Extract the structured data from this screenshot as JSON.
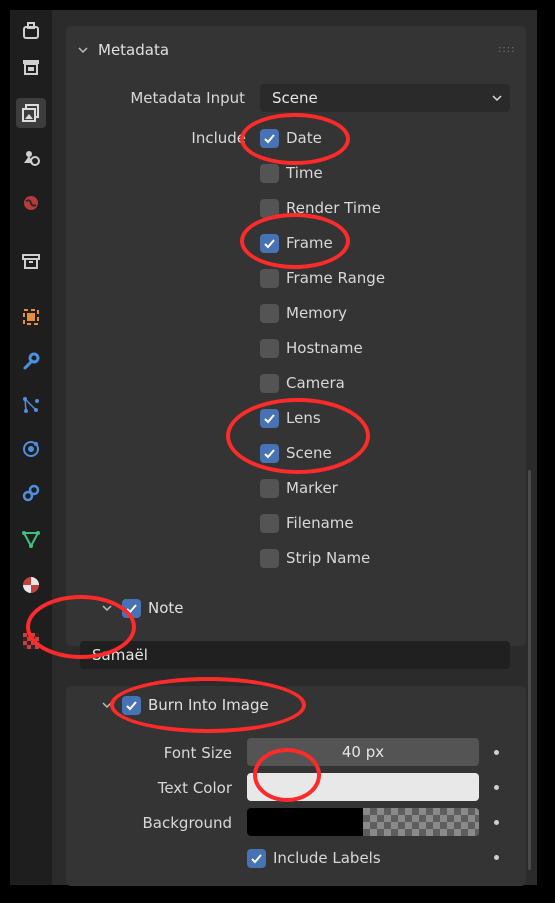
{
  "sidebar_tabs": [
    {
      "name": "tool-tab",
      "icon": "tool-icon"
    },
    {
      "name": "render-tab",
      "icon": "render-icon"
    },
    {
      "name": "output-tab",
      "icon": "output-icon",
      "active": true
    },
    {
      "name": "view-layer-tab",
      "icon": "view-layer-icon"
    },
    {
      "name": "scene-tab",
      "icon": "scene-icon"
    },
    {
      "name": "world-tab",
      "icon": "world-icon"
    },
    {
      "name": "collection-tab",
      "icon": "collection-icon"
    },
    {
      "name": "object-tab",
      "icon": "object-icon"
    },
    {
      "name": "modifier-tab",
      "icon": "wrench-icon"
    },
    {
      "name": "particles-tab",
      "icon": "particles-icon"
    },
    {
      "name": "physics-tab",
      "icon": "physics-icon"
    },
    {
      "name": "constraints-tab",
      "icon": "constraints-icon"
    },
    {
      "name": "data-tab",
      "icon": "mesh-data-icon"
    },
    {
      "name": "material-tab",
      "icon": "material-icon"
    },
    {
      "name": "texture-tab",
      "icon": "texture-icon"
    }
  ],
  "metadata": {
    "title": "Metadata",
    "input_label": "Metadata Input",
    "input_value": "Scene",
    "include_label": "Include",
    "items": [
      {
        "label": "Date",
        "checked": true
      },
      {
        "label": "Time",
        "checked": false
      },
      {
        "label": "Render Time",
        "checked": false
      },
      {
        "label": "Frame",
        "checked": true
      },
      {
        "label": "Frame Range",
        "checked": false
      },
      {
        "label": "Memory",
        "checked": false
      },
      {
        "label": "Hostname",
        "checked": false
      },
      {
        "label": "Camera",
        "checked": false
      },
      {
        "label": "Lens",
        "checked": true
      },
      {
        "label": "Scene",
        "checked": true
      },
      {
        "label": "Marker",
        "checked": false
      },
      {
        "label": "Filename",
        "checked": false
      },
      {
        "label": "Strip Name",
        "checked": false
      }
    ]
  },
  "note": {
    "label": "Note",
    "checked": true,
    "text": "Samaël"
  },
  "burn": {
    "label": "Burn Into Image",
    "checked": true,
    "font_size_label": "Font Size",
    "font_size_value": "40 px",
    "text_color_label": "Text Color",
    "text_color": "#e8e8e8",
    "background_label": "Background",
    "background_color": "#000000",
    "include_labels_label": "Include Labels",
    "include_labels_checked": true
  },
  "colors": {
    "accent": "#4772b3",
    "annotation": "#ff2a2a",
    "panel": "#2b2b2b"
  }
}
